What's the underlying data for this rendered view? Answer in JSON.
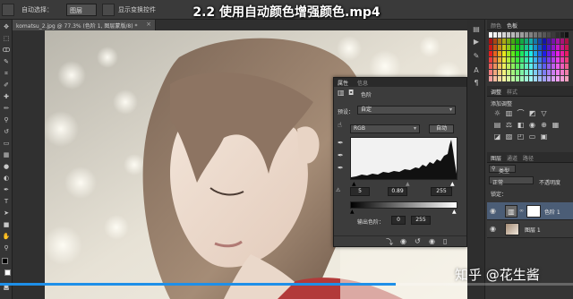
{
  "video": {
    "title": "2.2 使用自动颜色增强颜色.mp4",
    "progress": 0.69
  },
  "watermark": "知乎 @花生酱",
  "options_bar": {
    "auto_select_label": "自动选择：",
    "auto_select_value": "图层",
    "show_transform_label": "显示变换控件"
  },
  "document_tab": {
    "title": "komatsu_2.jpg @ 77.3% (色阶 1, 图层蒙版/8) *",
    "close": "×"
  },
  "right_dock": {
    "color_tabs": [
      "颜色",
      "色板"
    ],
    "adjust_tabs": [
      "调整",
      "样式"
    ],
    "adjust_title": "添加调整",
    "layers_tabs": [
      "图层",
      "通道",
      "路径"
    ],
    "kind_label": "类型",
    "blend_mode": "正常",
    "opacity_label": "不透明度",
    "lock_label": "锁定：",
    "layers": [
      {
        "name": "色阶 1",
        "type": "adjustment"
      },
      {
        "name": "图层 1",
        "type": "image"
      }
    ]
  },
  "properties": {
    "tabs": [
      "属性",
      "信息"
    ],
    "adjust_name": "色阶",
    "preset_label": "预设：",
    "preset_value": "自定",
    "channel": "RGB",
    "auto_button": "自动",
    "input_black": "5",
    "input_gamma": "0.89",
    "input_white": "255",
    "output_label": "输出色阶：",
    "output_black": "0",
    "output_white": "255"
  },
  "colors": {
    "accent": "#1e8fe8",
    "panel": "#3c3c3c",
    "dark": "#2b2b2b"
  }
}
